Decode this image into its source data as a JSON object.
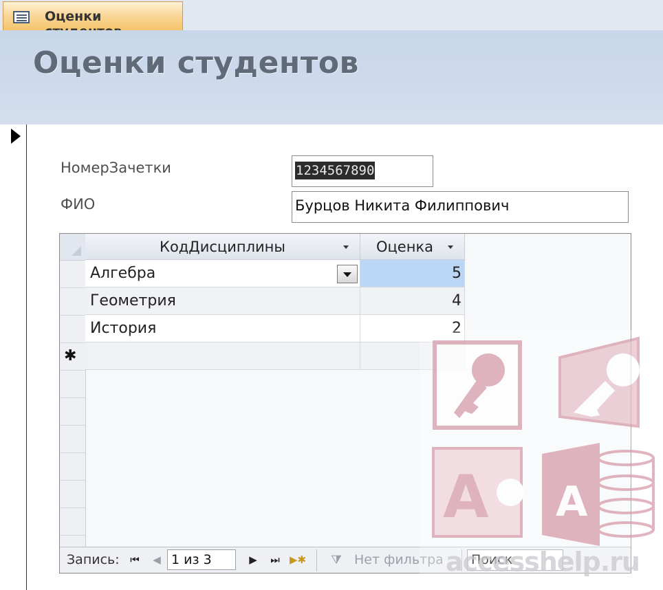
{
  "tab": {
    "icon": "form-icon",
    "title": "Оценки студентов"
  },
  "form": {
    "title": "Оценки студентов",
    "fields": {
      "record_book_label": "НомерЗачетки",
      "record_book_value": "1234567890",
      "name_label": "ФИО",
      "name_value": "Бурцов Никита Филиппович"
    }
  },
  "subform": {
    "columns": [
      "КодДисциплины",
      "Оценка"
    ],
    "rows": [
      {
        "discipline": "Алгебра",
        "grade": "5"
      },
      {
        "discipline": "Геометрия",
        "grade": "4"
      },
      {
        "discipline": "История",
        "grade": "2"
      }
    ],
    "new_row_marker": "✱"
  },
  "navigation": {
    "record_label": "Запись:",
    "position": "1 из 3",
    "filter_label": "Нет фильтра",
    "search_value": "Поиск"
  },
  "watermark": {
    "text": "accesshelp.ru",
    "colors": {
      "pink": "#d9a0ae",
      "white": "#ffffff"
    }
  }
}
